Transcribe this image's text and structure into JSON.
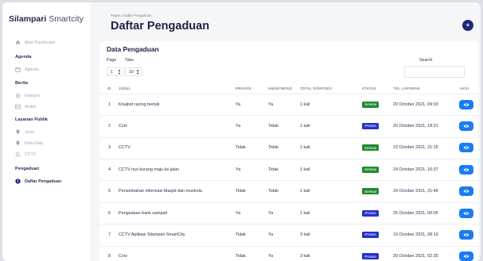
{
  "app": {
    "brand_bold": "Silampari",
    "brand_light": "Smartcity"
  },
  "sidebar": {
    "main_dashboard": "Main Dashboard",
    "sections": [
      {
        "title": "Agenda",
        "items": [
          {
            "label": "Agenda",
            "icon": "calendar-icon"
          }
        ]
      },
      {
        "title": "Berita",
        "items": [
          {
            "label": "Kategori",
            "icon": "settings-icon"
          },
          {
            "label": "Artikel",
            "icon": "list-icon"
          }
        ]
      },
      {
        "title": "Layanan Publik",
        "items": [
          {
            "label": "Jenis",
            "icon": "location-pin-icon"
          },
          {
            "label": "Peta Data",
            "icon": "location-pin-icon"
          },
          {
            "label": "CCTV",
            "icon": "camera-icon"
          }
        ]
      },
      {
        "title": "Pengaduan",
        "items": [
          {
            "label": "Daftar Pengaduan",
            "icon": "info-icon",
            "active": true
          }
        ]
      }
    ]
  },
  "header": {
    "breadcrumb": "Pages / Daftar Pengaduan",
    "title": "Daftar Pengaduan",
    "avatar_symbol": "+"
  },
  "card": {
    "title": "Data Pengaduan",
    "page_label": "Page",
    "take_label": "Take",
    "page_value": "1",
    "take_value": "10",
    "search_label": "Search",
    "search_value": ""
  },
  "table": {
    "columns": [
      "ID",
      "JUDUL",
      "PRIVATE",
      "ANONYMOUS",
      "TOTAL DISPOSISI",
      "STATUS",
      "TGL LAPORAN",
      "AKSI"
    ],
    "rows": [
      {
        "id": "1",
        "judul": "Knalpot racing berisik",
        "private": "Ya",
        "anonymous": "Ya",
        "disposisi": "1 kali",
        "status": "Selesai",
        "tgl": "20 October 2021, 09:03"
      },
      {
        "id": "2",
        "judul": "Cctv",
        "private": "Ya",
        "anonymous": "Tidak",
        "disposisi": "1 kali",
        "status": "Proses",
        "tgl": "20 October 2021, 18:21"
      },
      {
        "id": "3",
        "judul": "CCTV",
        "private": "Tidak",
        "anonymous": "Tidak",
        "disposisi": "1 kali",
        "status": "Selesai",
        "tgl": "23 October 2021, 21:15"
      },
      {
        "id": "4",
        "judul": "CCTV nyo kurang maju ke jalan",
        "private": "Ya",
        "anonymous": "Tidak",
        "disposisi": "1 kali",
        "status": "Selesai",
        "tgl": "24 October 2021, 16:37"
      },
      {
        "id": "5",
        "judul": "Penambahan informasi Masjid dan mushola",
        "private": "Tidak",
        "anonymous": "Tidak",
        "disposisi": "1 kali",
        "status": "Selesai",
        "tgl": "24 October 2021, 21:46"
      },
      {
        "id": "6",
        "judul": "Pengadaan bank sampah",
        "private": "Ya",
        "anonymous": "Ya",
        "disposisi": "1 kali",
        "status": "Proses",
        "tgl": "25 October 2021, 00:05"
      },
      {
        "id": "7",
        "judul": "CCTV Aplikasi Silampari SmartCity",
        "private": "Tidak",
        "anonymous": "Ya",
        "disposisi": "3 kali",
        "status": "Proses",
        "tgl": "19 October 2021, 08:19"
      },
      {
        "id": "8",
        "judul": "Cctv",
        "private": "Tidak",
        "anonymous": "Ya",
        "disposisi": "3 kali",
        "status": "Proses",
        "tgl": "20 October 2021, 02:35"
      }
    ]
  },
  "colors": {
    "selesai": "#1f8a2f",
    "proses": "#2433c9",
    "action": "#1a7cf4",
    "avatar": "#1e2a78"
  }
}
